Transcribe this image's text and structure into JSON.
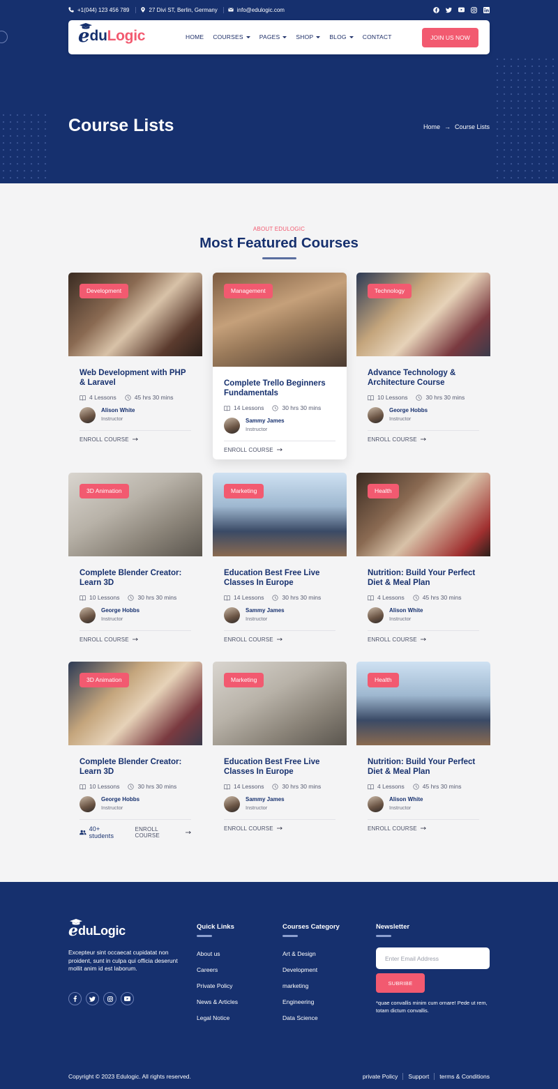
{
  "topbar": {
    "phone": "+1(044) 123 456 789",
    "address": "27 Divi ST, Berlin, Germany",
    "email": "info@edulogic.com",
    "social_icons": [
      "facebook-icon",
      "twitter-icon",
      "youtube-icon",
      "instagram-icon",
      "linkedin-icon"
    ]
  },
  "brand": {
    "letter": "e",
    "du": "du",
    "logic": "Logic"
  },
  "footer_brand": {
    "letter": "e",
    "rest": "duLogic"
  },
  "nav": {
    "items": [
      {
        "label": "HOME",
        "dropdown": false
      },
      {
        "label": "COURSES",
        "dropdown": true
      },
      {
        "label": "PAGES",
        "dropdown": true
      },
      {
        "label": "SHOP",
        "dropdown": true
      },
      {
        "label": "BLOG",
        "dropdown": true
      },
      {
        "label": "CONTACT",
        "dropdown": false
      }
    ],
    "cta": "JOIN US NOW"
  },
  "hero": {
    "title": "Course Lists",
    "breadcrumb": [
      "Home",
      "Course Lists"
    ]
  },
  "section": {
    "eyebrow": "ABOUT EDULOGIC",
    "title": "Most Featured Courses"
  },
  "courses": [
    {
      "category": "Development",
      "title": "Web Development with PHP & Laravel",
      "lessons": "4 Lessons",
      "duration": "45 hrs 30 mins",
      "instructor": "Alison White",
      "role": "Instructor",
      "enroll": "ENROLL COURSE"
    },
    {
      "category": "Management",
      "title": "Complete Trello Beginners Fundamentals",
      "lessons": "14 Lessons",
      "duration": "30 hrs 30 mins",
      "instructor": "Sammy James",
      "role": "Instructor",
      "enroll": "ENROLL COURSE"
    },
    {
      "category": "Technology",
      "title": "Advance Technology & Architecture Course",
      "lessons": "10 Lessons",
      "duration": "30 hrs 30 mins",
      "instructor": "George Hobbs",
      "role": "Instructor",
      "enroll": "ENROLL COURSE"
    },
    {
      "category": "3D Animation",
      "title": "Complete Blender Creator: Learn 3D",
      "lessons": "10 Lessons",
      "duration": "30 hrs 30 mins",
      "instructor": "George Hobbs",
      "role": "Instructor",
      "enroll": "ENROLL COURSE"
    },
    {
      "category": "Marketing",
      "title": "Education Best Free Live Classes In Europe",
      "lessons": "14 Lessons",
      "duration": "30 hrs 30 mins",
      "instructor": "Sammy James",
      "role": "Instructor",
      "enroll": "ENROLL COURSE"
    },
    {
      "category": "Health",
      "title": "Nutrition: Build Your Perfect Diet & Meal Plan",
      "lessons": "4 Lessons",
      "duration": "45 hrs 30 mins",
      "instructor": "Alison White",
      "role": "Instructor",
      "enroll": "ENROLL COURSE"
    },
    {
      "category": "3D Animation",
      "title": "Complete Blender Creator: Learn 3D",
      "lessons": "10 Lessons",
      "duration": "30 hrs 30 mins",
      "instructor": "George Hobbs",
      "role": "Instructor",
      "enroll": "ENROLL COURSE",
      "students": "40+ students"
    },
    {
      "category": "Marketing",
      "title": "Education Best Free Live Classes In Europe",
      "lessons": "14 Lessons",
      "duration": "30 hrs 30 mins",
      "instructor": "Sammy James",
      "role": "Instructor",
      "enroll": "ENROLL COURSE"
    },
    {
      "category": "Health",
      "title": "Nutrition: Build Your Perfect Diet & Meal Plan",
      "lessons": "4 Lessons",
      "duration": "45 hrs 30 mins",
      "instructor": "Alison White",
      "role": "Instructor",
      "enroll": "ENROLL COURSE"
    }
  ],
  "footer": {
    "description": "Excepteur sint occaecat cupidatat non proident, sunt in culpa qui officia deserunt mollit anim id est laborum.",
    "social_icons": [
      "facebook-icon",
      "twitter-icon",
      "instagram-icon",
      "youtube-icon"
    ],
    "quick_links": {
      "heading": "Quick Links",
      "items": [
        "About us",
        "Careers",
        "Private Policy",
        "News & Articles",
        "Legal Notice"
      ]
    },
    "categories": {
      "heading": "Courses Category",
      "items": [
        "Art & Design",
        "Development",
        "marketing",
        "Engineering",
        "Data Science"
      ]
    },
    "newsletter": {
      "heading": "Newsletter",
      "placeholder": "Enter Email Address",
      "button": "SUBRIBE",
      "note": "*quae convallis minim cum ornare! Pede ut rem, totam dictum convallis."
    },
    "copyright": "Copyright © 2023 Edulogic. All rights reserved.",
    "legal": [
      "private Policy",
      "Support",
      "terms & Conditions"
    ]
  },
  "colors": {
    "navy": "#16306e",
    "accent": "#f25a70",
    "page_bg": "#f4f4f5"
  }
}
